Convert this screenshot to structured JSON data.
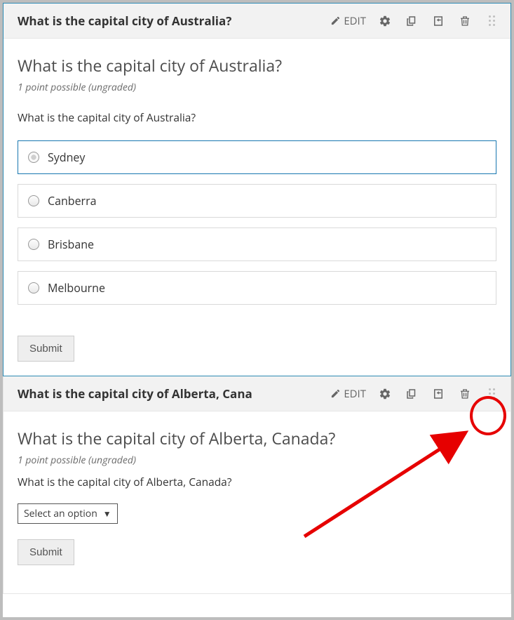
{
  "toolbar": {
    "edit_label": "EDIT"
  },
  "questions": [
    {
      "header_title": "What is the capital city of Australia?",
      "body_title": "What is the capital city of Australia?",
      "points_text": "1 point possible (ungraded)",
      "prompt": "What is the capital city of Australia?",
      "type": "radio",
      "options": [
        "Sydney",
        "Canberra",
        "Brisbane",
        "Melbourne"
      ],
      "selected_index": 0,
      "submit_label": "Submit"
    },
    {
      "header_title": "What is the capital city of Alberta, Cana",
      "body_title": "What is the capital city of Alberta, Canada?",
      "points_text": "1 point possible (ungraded)",
      "prompt": "What is the capital city of Alberta, Canada?",
      "type": "dropdown",
      "dropdown_placeholder": "Select an option",
      "submit_label": "Submit"
    }
  ]
}
